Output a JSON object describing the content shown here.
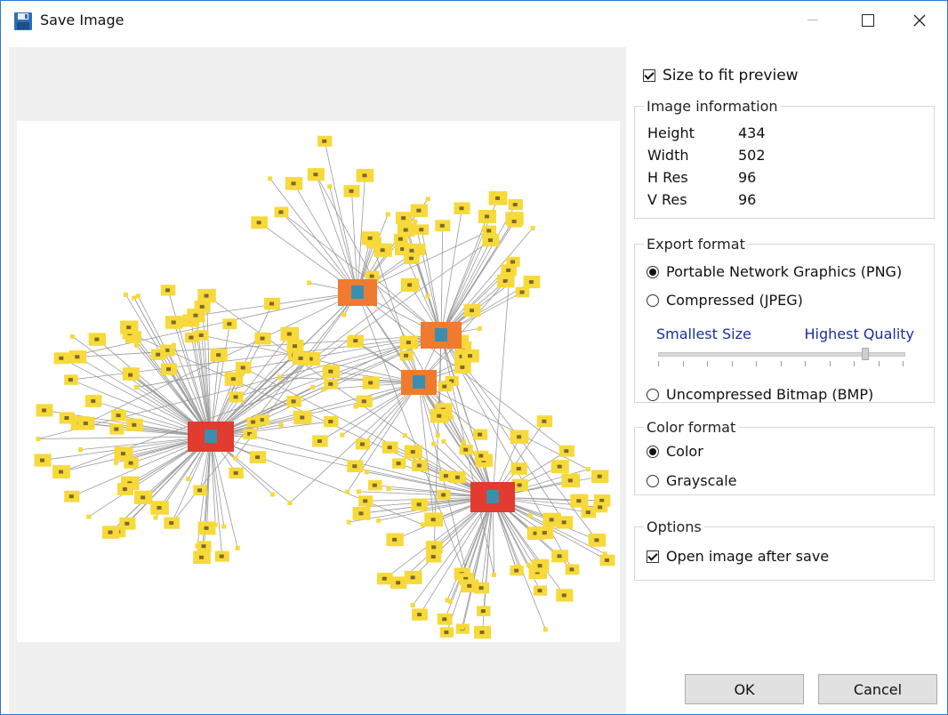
{
  "window": {
    "title": "Save Image"
  },
  "options_panel": {
    "size_to_fit": {
      "label": "Size to fit preview",
      "checked": true
    },
    "image_information": {
      "legend": "Image information",
      "rows": [
        {
          "key": "Height",
          "value": "434"
        },
        {
          "key": "Width",
          "value": "502"
        },
        {
          "key": "H Res",
          "value": "96"
        },
        {
          "key": "V Res",
          "value": "96"
        }
      ]
    },
    "export_format": {
      "legend": "Export format",
      "png_label": "Portable Network Graphics (PNG)",
      "jpeg_label": "Compressed (JPEG)",
      "bmp_label": "Uncompressed Bitmap (BMP)",
      "selected": "png",
      "quality_min_label": "Smallest Size",
      "quality_max_label": "Highest Quality",
      "quality_value_fraction": 0.85
    },
    "color_format": {
      "legend": "Color format",
      "color_label": "Color",
      "grayscale_label": "Grayscale",
      "selected": "color"
    },
    "options": {
      "legend": "Options",
      "open_after_save_label": "Open image after save",
      "open_after_save_checked": true
    }
  },
  "buttons": {
    "ok": "OK",
    "cancel": "Cancel"
  },
  "colors": {
    "accent_blue": "#1a2f9c",
    "window_border": "#2b79d0",
    "node_yellow": "#f7d93a",
    "hub_red": "#e23b30",
    "hub_orange": "#f07a2e",
    "edge_gray": "#9a9a9a"
  }
}
